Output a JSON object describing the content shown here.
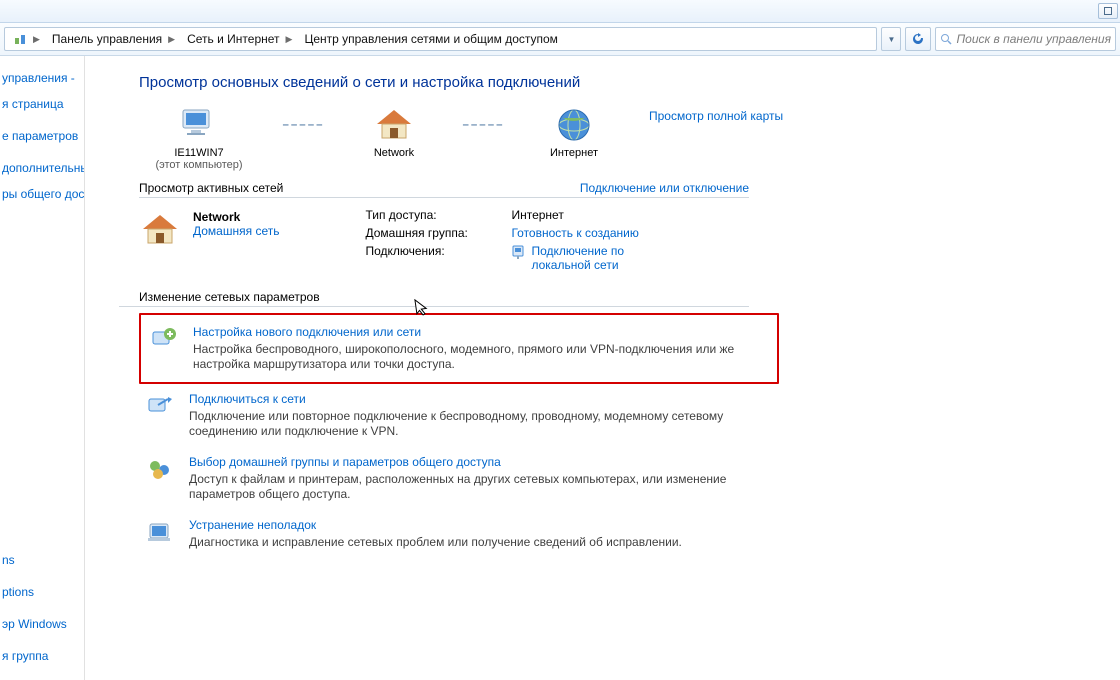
{
  "addressbar": {
    "crumbs": [
      "Панель управления",
      "Сеть и Интернет",
      "Центр управления сетями и общим доступом"
    ],
    "refresh_tip": "Обновить",
    "search_placeholder": "Поиск в панели управления"
  },
  "sidebar": {
    "items": [
      "управления -",
      "я страница",
      "е параметров",
      "дополнительные",
      "ры общего доступа"
    ],
    "see_also_header": "",
    "see_also": [
      "ns",
      "ptions",
      "эр Windows",
      "я группа"
    ]
  },
  "main": {
    "title": "Просмотр основных сведений о сети и настройка подключений",
    "nodes": {
      "pc_name": "IE11WIN7",
      "pc_sub": "(этот компьютер)",
      "network": "Network",
      "internet": "Интернет"
    },
    "full_map": "Просмотр полной карты",
    "active_header": "Просмотр активных сетей",
    "connect_disconnect": "Подключение или отключение",
    "active": {
      "name": "Network",
      "type": "Домашняя сеть",
      "access_lbl": "Тип доступа:",
      "access_val": "Интернет",
      "homegroup_lbl": "Домашняя группа:",
      "homegroup_val": "Готовность к созданию",
      "connections_lbl": "Подключения:",
      "connections_val": "Подключение по локальной сети"
    },
    "settings_header": "Изменение сетевых параметров",
    "tasks": [
      {
        "title": "Настройка нового подключения или сети",
        "desc": "Настройка беспроводного, широкополосного, модемного, прямого или VPN-подключения или же настройка маршрутизатора или точки доступа."
      },
      {
        "title": "Подключиться к сети",
        "desc": "Подключение или повторное подключение к беспроводному, проводному, модемному сетевому соединению или подключение к VPN."
      },
      {
        "title": "Выбор домашней группы и параметров общего доступа",
        "desc": "Доступ к файлам и принтерам, расположенных на других сетевых компьютерах, или изменение параметров общего доступа."
      },
      {
        "title": "Устранение неполадок",
        "desc": "Диагностика и исправление сетевых проблем или получение сведений об исправлении."
      }
    ]
  }
}
